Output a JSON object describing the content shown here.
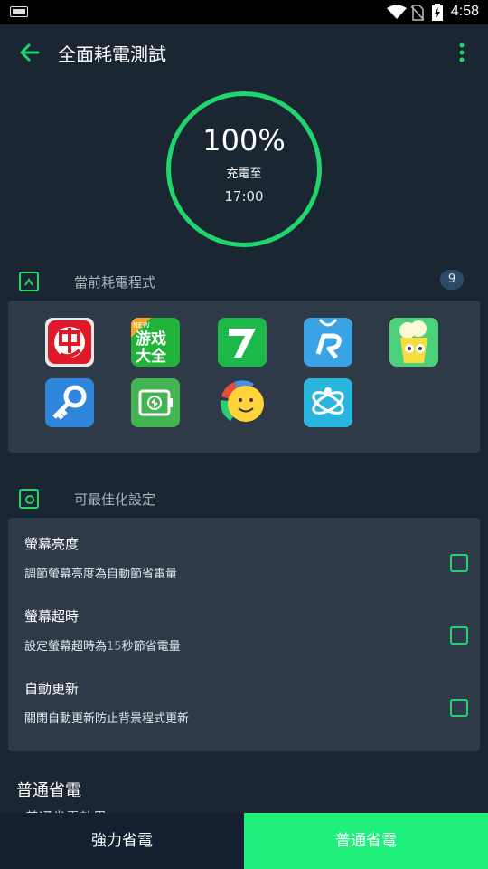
{
  "status_bar": {
    "time": "4:58",
    "battery_small_label": "100",
    "icons": [
      "battery-small-icon",
      "wifi-icon",
      "no-sim-icon",
      "battery-charging-icon"
    ]
  },
  "app_bar": {
    "title": "全面耗電測試",
    "back_icon": "back-arrow-icon",
    "menu_icon": "more-vert-icon"
  },
  "charge": {
    "percent": "100%",
    "label": "充電至",
    "time": "17:00"
  },
  "apps_section": {
    "title": "當前耗電程式",
    "count": "9",
    "apps": [
      {
        "icon": "red-chinese-character-app-icon"
      },
      {
        "icon": "game-center-app-icon",
        "text": "游戏大全",
        "badge": "NEW"
      },
      {
        "icon": "green-seven-app-icon"
      },
      {
        "icon": "blue-r-app-icon"
      },
      {
        "icon": "popcorn-game-app-icon"
      },
      {
        "icon": "key-app-icon"
      },
      {
        "icon": "battery-app-icon"
      },
      {
        "icon": "smiley-sun-app-icon"
      },
      {
        "icon": "atom-app-icon"
      }
    ]
  },
  "optimize_section": {
    "title": "可最佳化設定",
    "items": [
      {
        "title": "螢幕亮度",
        "desc": "調節螢幕亮度為自動節省電量"
      },
      {
        "title": "螢幕超時",
        "desc_pre": "設定螢幕超時為",
        "desc_num": "15",
        "desc_post": "秒節省電量"
      },
      {
        "title": "自動更新",
        "desc": "關閉自動更新防止背景程式更新"
      }
    ]
  },
  "normal_section": {
    "title": "普通省電",
    "subtitle": "普通省電效果"
  },
  "bottom_buttons": {
    "strong": "強力省電",
    "normal": "普通省電"
  },
  "colors": {
    "accent": "#21d56d",
    "background": "#1b2633",
    "card": "#2e3a47",
    "button_primary": "#1ff07c",
    "button_dark": "#142030"
  }
}
